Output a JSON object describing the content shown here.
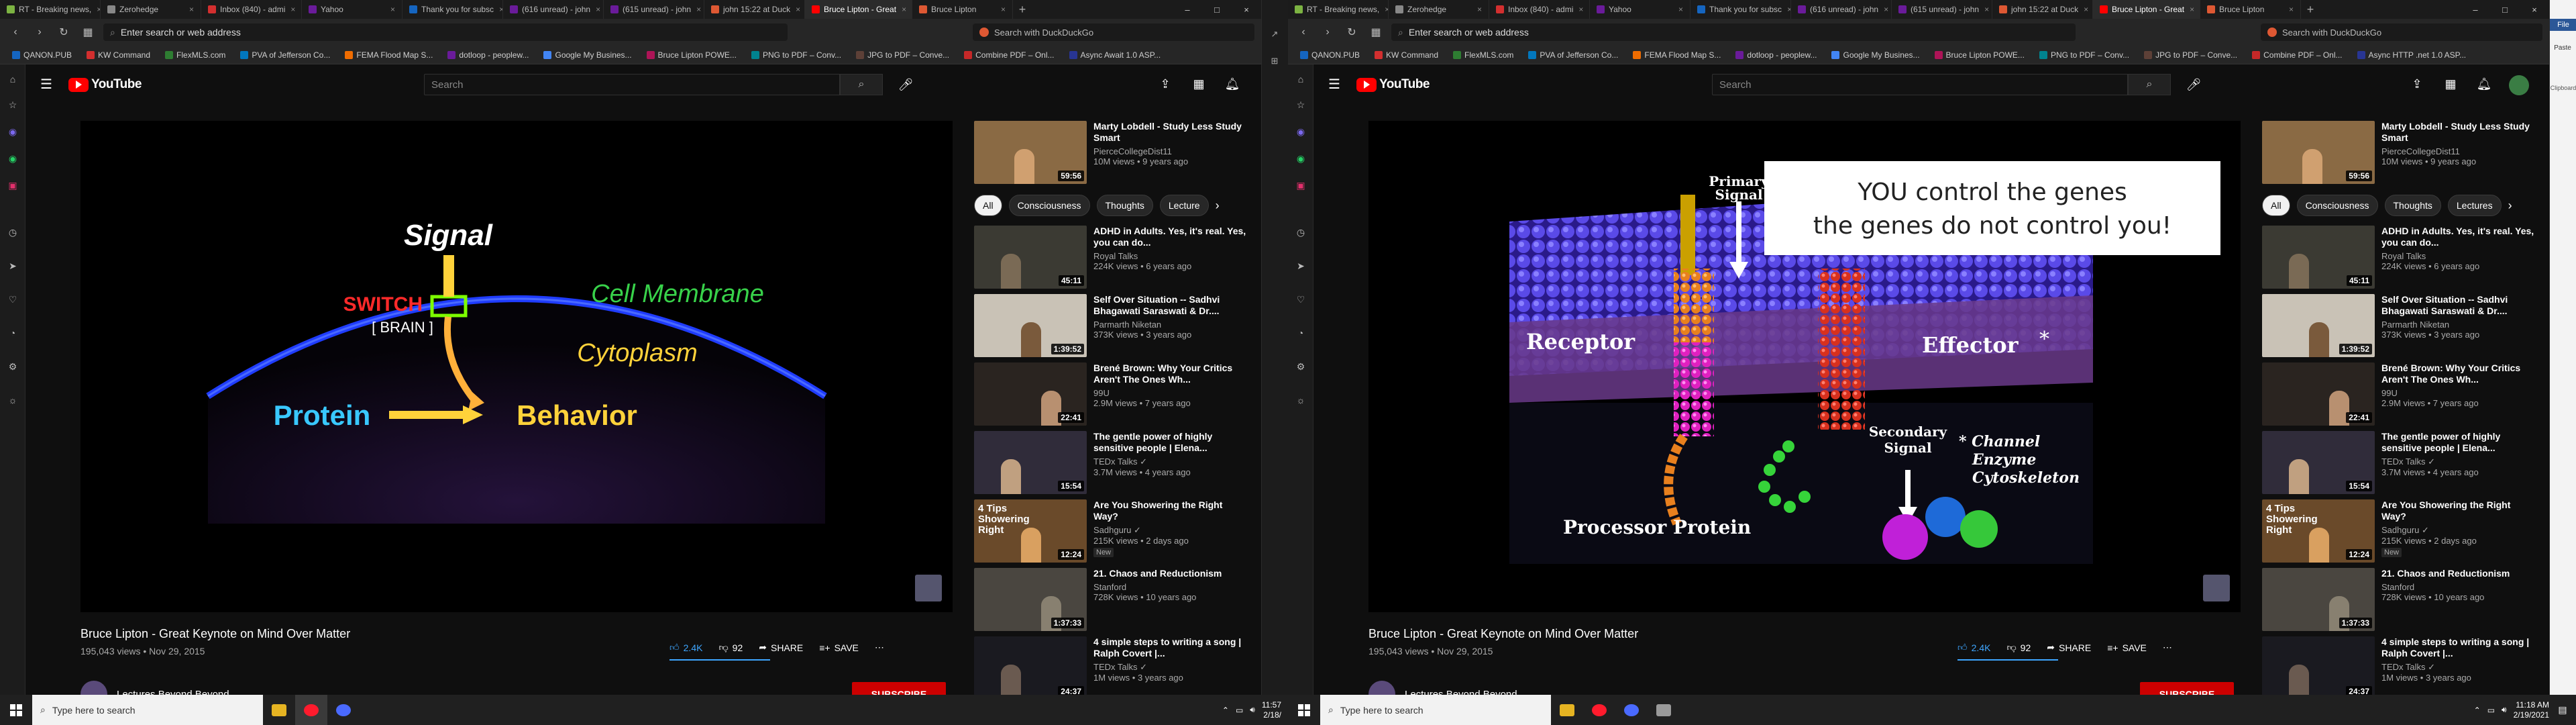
{
  "browser": {
    "tabs": [
      {
        "label": "RT - Breaking news,",
        "color": "#7cb342"
      },
      {
        "label": "Zerohedge",
        "color": "#888888"
      },
      {
        "label": "Inbox (840) - admi",
        "color": "#d32f2f"
      },
      {
        "label": "Yahoo",
        "color": "#6a1b9a"
      },
      {
        "label": "Thank you for subsc",
        "color": "#1565c0"
      },
      {
        "label": "(616 unread) - john",
        "color": "#6a1b9a"
      },
      {
        "label": "(615 unread) - john",
        "color": "#6a1b9a"
      },
      {
        "label": "john 15:22 at Duck",
        "color": "#de5833"
      },
      {
        "label": "Bruce Lipton - Great",
        "color": "#ff0000"
      },
      {
        "label": "Bruce Lipton",
        "color": "#de5833"
      }
    ],
    "address_placeholder": "Enter search or web address",
    "search_placeholder": "Search with DuckDuckGo",
    "bookmarks": [
      "QANON.PUB",
      "KW Command",
      "FlexMLS.com",
      "PVA of Jefferson Co...",
      "FEMA Flood Map S...",
      "dotloop - peoplew...",
      "Google My Busines...",
      "Bruce Lipton POWE...",
      "PNG to PDF – Conv...",
      "JPG to PDF – Conve...",
      "Combine PDF – Onl...",
      "Async Await 1.0 ASP..."
    ],
    "bookmarks_right": [
      "QANON.PUB",
      "KW Command",
      "FlexMLS.com",
      "PVA of Jefferson Co...",
      "FEMA Flood Map S...",
      "dotloop - peoplew...",
      "Google My Busines...",
      "Bruce Lipton POWE...",
      "PNG to PDF – Conv...",
      "JPG to PDF – Conve...",
      "Combine PDF – Onl...",
      "Async HTTP .net 1.0 ASP..."
    ]
  },
  "youtube": {
    "logo_text": "YouTube",
    "search_placeholder": "Search",
    "video_title": "Bruce Lipton - Great Keynote on Mind Over Matter",
    "views_date": "195,043 views • Nov 29, 2015",
    "likes": "2.4K",
    "dislikes": "92",
    "share": "SHARE",
    "save": "SAVE",
    "channel": "Lectures Beyond Beyond",
    "subscribe": "SUBSCRIBE",
    "chips": [
      "All",
      "Consciousness",
      "Thoughts",
      "Lectures"
    ],
    "chips_left": [
      "All",
      "Consciousness",
      "Thoughts",
      "Lecture"
    ],
    "featured": {
      "title": "Marty Lobdell - Study Less Study Smart",
      "channel": "PierceCollegeDist11",
      "meta": "10M views • 9 years ago",
      "duration": "59:56"
    },
    "recommendations": [
      {
        "title": "ADHD in Adults. Yes, it's real. Yes, you can do...",
        "channel": "Royal Talks",
        "meta": "224K views • 6 years ago",
        "duration": "45:11",
        "bg": "#3b3a33",
        "fig": "#7a6a55"
      },
      {
        "title": "Self Over Situation -- Sadhvi Bhagawati Saraswati & Dr....",
        "channel": "Parmarth Niketan",
        "meta": "373K views • 3 years ago",
        "duration": "1:39:52",
        "bg": "#c9c2b6",
        "fig": "#7a5a3c"
      },
      {
        "title": "Brené Brown: Why Your Critics Aren't The Ones Wh...",
        "channel": "99U",
        "meta": "2.9M views • 7 years ago",
        "duration": "22:41",
        "bg": "#2a2420",
        "fig": "#b89070"
      },
      {
        "title": "The gentle power of highly sensitive people | Elena...",
        "channel": "TEDx Talks ✓",
        "meta": "3.7M views • 4 years ago",
        "duration": "15:54",
        "bg": "#302c3a",
        "fig": "#c0a080"
      },
      {
        "title": "Are You Showering the Right Way?",
        "channel": "Sadhguru ✓",
        "meta": "215K views • 2 days ago",
        "duration": "12:24",
        "bg": "#6a4a2a",
        "fig": "#d9a060",
        "badge": "New",
        "overlay": "4 Tips Showering Right"
      },
      {
        "title": "21. Chaos and Reductionism",
        "channel": "Stanford",
        "meta": "728K views • 10 years ago",
        "duration": "1:37:33",
        "bg": "#4a4640",
        "fig": "#888070"
      },
      {
        "title": "4 simple steps to writing a song | Ralph Covert |...",
        "channel": "TEDx Talks ✓",
        "meta": "1M views • 3 years ago",
        "duration": "24:37",
        "bg": "#1a1a20",
        "fig": "#6a5a50"
      }
    ],
    "slide_left": {
      "signal": "Signal",
      "switch": "SWITCH",
      "brain": "[ BRAIN ]",
      "membrane": "Cell Membrane",
      "cytoplasm": "Cytoplasm",
      "protein": "Protein",
      "behavior": "Behavior"
    },
    "slide_right": {
      "banner_line1": "YOU control the genes",
      "banner_line2": "the genes do not control you!",
      "primary": "Primary",
      "signal": "Signal",
      "receptor": "Receptor",
      "effector": "Effector",
      "star": "*",
      "secondary": "Secondary",
      "signal2": "Signal",
      "channel": "* Channel",
      "enzyme": "Enzyme",
      "cytoskeleton": "Cytoskeleton",
      "processor": "Processor Protein"
    }
  },
  "taskbar": {
    "search_placeholder": "Type here to search",
    "time_left": "11:57",
    "date_left": "2/18/",
    "time_right": "11:18 AM",
    "date_right": "2/19/2021"
  },
  "right_panel": {
    "file": "File",
    "paste": "Paste",
    "clipboard": "Clipboard"
  }
}
